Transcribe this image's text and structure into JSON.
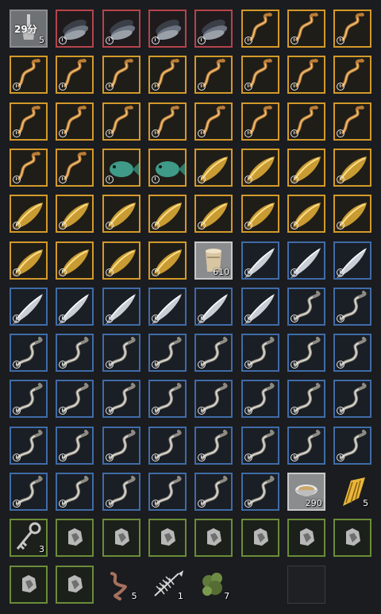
{
  "inventory": {
    "columns": 8,
    "slots": [
      {
        "icon": "lamp-icon",
        "rarity": "gray",
        "timer": "29分",
        "count": "5",
        "clock": false
      },
      {
        "icon": "fish-bundle-icon",
        "rarity": "red",
        "clock": true
      },
      {
        "icon": "fish-bundle-icon",
        "rarity": "red",
        "clock": true
      },
      {
        "icon": "fish-bundle-icon",
        "rarity": "red",
        "clock": true
      },
      {
        "icon": "fish-bundle-icon",
        "rarity": "red",
        "clock": true
      },
      {
        "icon": "eel-gold-icon",
        "rarity": "orange",
        "clock": true
      },
      {
        "icon": "eel-gold-icon",
        "rarity": "orange",
        "clock": true
      },
      {
        "icon": "eel-gold-icon",
        "rarity": "orange",
        "clock": true
      },
      {
        "icon": "eel-gold-icon",
        "rarity": "orange",
        "clock": true
      },
      {
        "icon": "eel-gold-icon",
        "rarity": "orange",
        "clock": true
      },
      {
        "icon": "eel-gold-icon",
        "rarity": "orange",
        "clock": true
      },
      {
        "icon": "eel-gold-icon",
        "rarity": "orange",
        "clock": true
      },
      {
        "icon": "eel-gold-icon",
        "rarity": "orange",
        "clock": true
      },
      {
        "icon": "eel-gold-icon",
        "rarity": "orange",
        "clock": true
      },
      {
        "icon": "eel-gold-icon",
        "rarity": "orange",
        "clock": true
      },
      {
        "icon": "eel-gold-icon",
        "rarity": "orange",
        "clock": true
      },
      {
        "icon": "eel-gold-icon",
        "rarity": "orange",
        "clock": true
      },
      {
        "icon": "eel-gold-icon",
        "rarity": "orange",
        "clock": true
      },
      {
        "icon": "eel-gold-icon",
        "rarity": "orange",
        "clock": true
      },
      {
        "icon": "eel-gold-icon",
        "rarity": "orange",
        "clock": true
      },
      {
        "icon": "eel-gold-icon",
        "rarity": "orange",
        "clock": true
      },
      {
        "icon": "eel-gold-icon",
        "rarity": "orange",
        "clock": true
      },
      {
        "icon": "eel-gold-icon",
        "rarity": "orange",
        "clock": true
      },
      {
        "icon": "eel-gold-icon",
        "rarity": "orange",
        "clock": true
      },
      {
        "icon": "eel-gold-icon",
        "rarity": "orange",
        "clock": true
      },
      {
        "icon": "eel-gold-icon",
        "rarity": "orange",
        "clock": true
      },
      {
        "icon": "green-fish-icon",
        "rarity": "orange",
        "clock": true
      },
      {
        "icon": "green-fish-icon",
        "rarity": "orange",
        "clock": true
      },
      {
        "icon": "golden-fish-icon",
        "rarity": "orange",
        "clock": true
      },
      {
        "icon": "golden-fish-icon",
        "rarity": "orange",
        "clock": true
      },
      {
        "icon": "golden-fish-icon",
        "rarity": "orange",
        "clock": true
      },
      {
        "icon": "golden-fish-icon",
        "rarity": "orange",
        "clock": true
      },
      {
        "icon": "golden-fish-icon",
        "rarity": "orange",
        "clock": true
      },
      {
        "icon": "golden-fish-icon",
        "rarity": "orange",
        "clock": true
      },
      {
        "icon": "golden-fish-icon",
        "rarity": "orange",
        "clock": true
      },
      {
        "icon": "golden-fish-icon",
        "rarity": "orange",
        "clock": true
      },
      {
        "icon": "golden-fish-icon",
        "rarity": "orange",
        "clock": true
      },
      {
        "icon": "golden-fish-icon",
        "rarity": "orange",
        "clock": true
      },
      {
        "icon": "golden-fish-icon",
        "rarity": "orange",
        "clock": true
      },
      {
        "icon": "golden-fish-icon",
        "rarity": "orange",
        "clock": true
      },
      {
        "icon": "golden-fish-icon",
        "rarity": "orange",
        "clock": true
      },
      {
        "icon": "golden-fish-icon",
        "rarity": "orange",
        "clock": true
      },
      {
        "icon": "golden-fish-icon",
        "rarity": "orange",
        "clock": true
      },
      {
        "icon": "golden-fish-icon",
        "rarity": "orange",
        "clock": true
      },
      {
        "icon": "bucket-icon",
        "rarity": "white",
        "count": "610",
        "clock": false
      },
      {
        "icon": "silver-fish-icon",
        "rarity": "blue",
        "clock": true
      },
      {
        "icon": "silver-fish-icon",
        "rarity": "blue",
        "clock": true
      },
      {
        "icon": "silver-fish-icon",
        "rarity": "blue",
        "clock": true
      },
      {
        "icon": "silver-fish-icon",
        "rarity": "blue",
        "clock": true
      },
      {
        "icon": "silver-fish-icon",
        "rarity": "blue",
        "clock": true
      },
      {
        "icon": "silver-fish-icon",
        "rarity": "blue",
        "clock": true
      },
      {
        "icon": "silver-fish-icon",
        "rarity": "blue",
        "clock": true
      },
      {
        "icon": "silver-fish-icon",
        "rarity": "blue",
        "clock": true
      },
      {
        "icon": "silver-fish-icon",
        "rarity": "blue",
        "clock": true
      },
      {
        "icon": "eel-silver-icon",
        "rarity": "blue",
        "clock": true
      },
      {
        "icon": "eel-silver-icon",
        "rarity": "blue",
        "clock": true
      },
      {
        "icon": "eel-silver-icon",
        "rarity": "blue",
        "clock": true
      },
      {
        "icon": "eel-silver-icon",
        "rarity": "blue",
        "clock": true
      },
      {
        "icon": "eel-silver-icon",
        "rarity": "blue",
        "clock": true
      },
      {
        "icon": "eel-silver-icon",
        "rarity": "blue",
        "clock": true
      },
      {
        "icon": "eel-silver-icon",
        "rarity": "blue",
        "clock": true
      },
      {
        "icon": "eel-silver-icon",
        "rarity": "blue",
        "clock": true
      },
      {
        "icon": "eel-silver-icon",
        "rarity": "blue",
        "clock": true
      },
      {
        "icon": "eel-silver-icon",
        "rarity": "blue",
        "clock": true
      },
      {
        "icon": "eel-silver-icon",
        "rarity": "blue",
        "clock": true
      },
      {
        "icon": "eel-silver-icon",
        "rarity": "blue",
        "clock": true
      },
      {
        "icon": "eel-silver-icon",
        "rarity": "blue",
        "clock": true
      },
      {
        "icon": "eel-silver-icon",
        "rarity": "blue",
        "clock": true
      },
      {
        "icon": "eel-silver-icon",
        "rarity": "blue",
        "clock": true
      },
      {
        "icon": "eel-silver-icon",
        "rarity": "blue",
        "clock": true
      },
      {
        "icon": "eel-silver-icon",
        "rarity": "blue",
        "clock": true
      },
      {
        "icon": "eel-silver-icon",
        "rarity": "blue",
        "clock": true
      },
      {
        "icon": "eel-silver-icon",
        "rarity": "blue",
        "clock": true
      },
      {
        "icon": "eel-silver-icon",
        "rarity": "blue",
        "clock": true
      },
      {
        "icon": "eel-silver-icon",
        "rarity": "blue",
        "clock": true
      },
      {
        "icon": "eel-silver-icon",
        "rarity": "blue",
        "clock": true
      },
      {
        "icon": "eel-silver-icon",
        "rarity": "blue",
        "clock": true
      },
      {
        "icon": "eel-silver-icon",
        "rarity": "blue",
        "clock": true
      },
      {
        "icon": "eel-silver-icon",
        "rarity": "blue",
        "clock": true
      },
      {
        "icon": "eel-silver-icon",
        "rarity": "blue",
        "clock": true
      },
      {
        "icon": "eel-silver-icon",
        "rarity": "blue",
        "clock": true
      },
      {
        "icon": "eel-silver-icon",
        "rarity": "blue",
        "clock": true
      },
      {
        "icon": "eel-silver-icon",
        "rarity": "blue",
        "clock": true
      },
      {
        "icon": "eel-silver-icon",
        "rarity": "blue",
        "clock": true
      },
      {
        "icon": "eel-silver-icon",
        "rarity": "blue",
        "clock": true
      },
      {
        "icon": "eel-silver-icon",
        "rarity": "blue",
        "clock": true
      },
      {
        "icon": "bowl-icon",
        "rarity": "white",
        "count": "290",
        "clock": false
      },
      {
        "icon": "golden-wing-icon",
        "rarity": "none",
        "count": "5",
        "clock": false
      },
      {
        "icon": "key-icon",
        "rarity": "green",
        "count": "3",
        "clock": false
      },
      {
        "icon": "ore-icon",
        "rarity": "green",
        "clock": false
      },
      {
        "icon": "ore-icon",
        "rarity": "green",
        "clock": false
      },
      {
        "icon": "ore-icon",
        "rarity": "green",
        "clock": false
      },
      {
        "icon": "ore-icon",
        "rarity": "green",
        "clock": false
      },
      {
        "icon": "ore-icon",
        "rarity": "green",
        "clock": false
      },
      {
        "icon": "ore-icon",
        "rarity": "green",
        "clock": false
      },
      {
        "icon": "ore-icon",
        "rarity": "green",
        "clock": false
      },
      {
        "icon": "ore-icon",
        "rarity": "green",
        "clock": false
      },
      {
        "icon": "ore-icon",
        "rarity": "green",
        "clock": false
      },
      {
        "icon": "worm-icon",
        "rarity": "none",
        "count": "5",
        "clock": false
      },
      {
        "icon": "fish-bone-icon",
        "rarity": "none",
        "count": "1",
        "clock": false
      },
      {
        "icon": "seaweed-icon",
        "rarity": "none",
        "count": "7",
        "clock": false
      },
      {
        "icon": "empty-slot",
        "rarity": "none",
        "clock": false
      },
      {
        "icon": "empty-slot",
        "rarity": "empty",
        "clock": false
      },
      {
        "icon": "empty-slot",
        "rarity": "none",
        "clock": false
      }
    ]
  }
}
